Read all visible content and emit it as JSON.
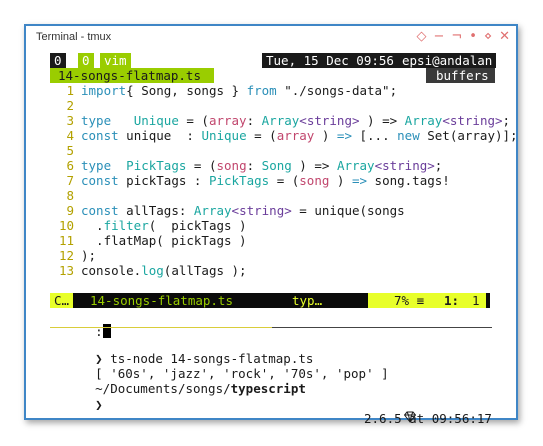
{
  "window": {
    "title": "Terminal - tmux",
    "btn_restore": "◇",
    "btn_min": "−",
    "btn_max": "¬",
    "btn_dot": "•",
    "btn_sticky": "⋄",
    "btn_close": "✕"
  },
  "tmux": {
    "session": "0",
    "window_index": "0",
    "window_name": "vim",
    "clock": "Tue, 15 Dec 09:56",
    "host": "epsi@andalan"
  },
  "vim": {
    "tab_file": "14-songs-flatmap.ts",
    "tab_buffers": "buffers",
    "lines": [
      {
        "n": "1",
        "parts": [
          [
            "kw",
            "import"
          ],
          [
            "",
            "{ Song, songs } "
          ],
          [
            "kw",
            "from"
          ],
          [
            "str",
            " \"./songs-data\";"
          ]
        ]
      },
      {
        "n": "2",
        "parts": []
      },
      {
        "n": "3",
        "parts": [
          [
            "kw",
            "type"
          ],
          [
            "",
            "   "
          ],
          [
            "type",
            "Unique"
          ],
          [
            "",
            " = ("
          ],
          [
            "param",
            "array"
          ],
          [
            "",
            ": "
          ],
          [
            "type",
            "Array"
          ],
          [
            "gen",
            "<"
          ],
          [
            "gen",
            "string"
          ],
          [
            "gen",
            ">"
          ],
          [
            "",
            " ) => "
          ],
          [
            "type",
            "Array"
          ],
          [
            "gen",
            "<"
          ],
          [
            "gen",
            "string"
          ],
          [
            "gen",
            ">"
          ],
          [
            "",
            ";"
          ]
        ]
      },
      {
        "n": "4",
        "parts": [
          [
            "kw",
            "const"
          ],
          [
            "",
            " unique  : "
          ],
          [
            "type",
            "Unique"
          ],
          [
            "",
            " = ("
          ],
          [
            "param",
            "array"
          ],
          [
            "",
            " ) "
          ],
          [
            "kw",
            "=>"
          ],
          [
            "",
            " [... "
          ],
          [
            "kw",
            "new"
          ],
          [
            "",
            " Set(array)];"
          ]
        ]
      },
      {
        "n": "5",
        "parts": []
      },
      {
        "n": "6",
        "parts": [
          [
            "kw",
            "type"
          ],
          [
            "",
            "  "
          ],
          [
            "type",
            "PickTags"
          ],
          [
            "",
            " = ("
          ],
          [
            "param",
            "song"
          ],
          [
            "",
            ": "
          ],
          [
            "type",
            "Song"
          ],
          [
            "",
            " ) => "
          ],
          [
            "type",
            "Array"
          ],
          [
            "gen",
            "<"
          ],
          [
            "gen",
            "string"
          ],
          [
            "gen",
            ">"
          ],
          [
            "",
            ";"
          ]
        ]
      },
      {
        "n": "7",
        "parts": [
          [
            "kw",
            "const"
          ],
          [
            "",
            " pickTags : "
          ],
          [
            "type",
            "PickTags"
          ],
          [
            "",
            " = ("
          ],
          [
            "param",
            "song"
          ],
          [
            "",
            " ) "
          ],
          [
            "kw",
            "=>"
          ],
          [
            "",
            " song.tags!"
          ]
        ]
      },
      {
        "n": "8",
        "parts": []
      },
      {
        "n": "9",
        "parts": [
          [
            "kw",
            "const"
          ],
          [
            "",
            " allTags: "
          ],
          [
            "type",
            "Array"
          ],
          [
            "gen",
            "<"
          ],
          [
            "gen",
            "string"
          ],
          [
            "gen",
            ">"
          ],
          [
            "",
            " = unique(songs"
          ]
        ]
      },
      {
        "n": "10",
        "parts": [
          [
            "",
            "  ."
          ],
          [
            "fn",
            "filter"
          ],
          [
            "",
            "(  pickTags )"
          ]
        ]
      },
      {
        "n": "11",
        "parts": [
          [
            "",
            "  .flatMap( pickTags )"
          ]
        ]
      },
      {
        "n": "12",
        "parts": [
          [
            "",
            ");"
          ]
        ]
      },
      {
        "n": "13",
        "parts": [
          [
            "",
            "console."
          ],
          [
            "fn",
            "log"
          ],
          [
            "",
            "(allTags );"
          ]
        ]
      }
    ],
    "tilde": "~",
    "statusline": {
      "mode": "C…",
      "file": "14-songs-flatmap.ts",
      "filetype": "typ…",
      "percent": "7% ≡",
      "line": "1:",
      "col": "1"
    },
    "cmdline": ":"
  },
  "shell": {
    "prompt_char": "❯",
    "command": "ts-node 14-songs-flatmap.ts",
    "output": "[ '60s', 'jazz', 'rock', '70s', 'pop' ]",
    "cwd_prefix": "~/Documents/songs/",
    "cwd_bold": "typescript",
    "ruby_icon": "gem-icon",
    "version_info": "2.6.5 at 09:56:17",
    "colors": {
      "tmux_green": "#9acd00",
      "tmux_yellow": "#e8ff2a",
      "accent_blue": "#3f86c6"
    }
  }
}
